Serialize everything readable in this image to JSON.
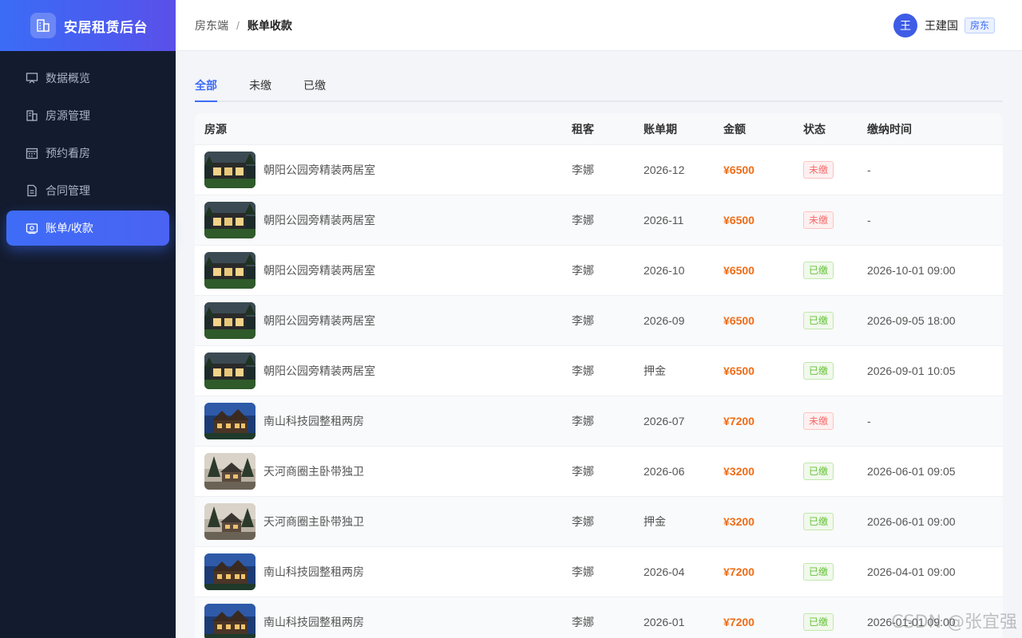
{
  "brand": {
    "title": "安居租赁后台",
    "icon": "building-icon"
  },
  "sidebar": {
    "items": [
      {
        "label": "数据概览",
        "icon": "dashboard-icon",
        "active": false
      },
      {
        "label": "房源管理",
        "icon": "building-icon",
        "active": false
      },
      {
        "label": "预约看房",
        "icon": "calendar-icon",
        "active": false
      },
      {
        "label": "合同管理",
        "icon": "document-icon",
        "active": false
      },
      {
        "label": "账单/收款",
        "icon": "bill-icon",
        "active": true
      }
    ]
  },
  "header": {
    "breadcrumb": [
      "房东端",
      "账单收款"
    ],
    "separator": "/",
    "user": {
      "avatar_text": "王",
      "name": "王建国",
      "role": "房东"
    }
  },
  "tabs": [
    {
      "label": "全部",
      "active": true
    },
    {
      "label": "未缴",
      "active": false
    },
    {
      "label": "已缴",
      "active": false
    }
  ],
  "table": {
    "columns": [
      "房源",
      "租客",
      "账单期",
      "金额",
      "状态",
      "缴纳时间"
    ],
    "rows": [
      {
        "house": "朝阳公园旁精装两居室",
        "tenant": "李娜",
        "period": "2026-12",
        "amount": "¥6500",
        "status": "未缴",
        "paid_time": "-"
      },
      {
        "house": "朝阳公园旁精装两居室",
        "tenant": "李娜",
        "period": "2026-11",
        "amount": "¥6500",
        "status": "未缴",
        "paid_time": "-"
      },
      {
        "house": "朝阳公园旁精装两居室",
        "tenant": "李娜",
        "period": "2026-10",
        "amount": "¥6500",
        "status": "已缴",
        "paid_time": "2026-10-01 09:00"
      },
      {
        "house": "朝阳公园旁精装两居室",
        "tenant": "李娜",
        "period": "2026-09",
        "amount": "¥6500",
        "status": "已缴",
        "paid_time": "2026-09-05 18:00"
      },
      {
        "house": "朝阳公园旁精装两居室",
        "tenant": "李娜",
        "period": "押金",
        "amount": "¥6500",
        "status": "已缴",
        "paid_time": "2026-09-01 10:05"
      },
      {
        "house": "南山科技园整租两房",
        "tenant": "李娜",
        "period": "2026-07",
        "amount": "¥7200",
        "status": "未缴",
        "paid_time": "-"
      },
      {
        "house": "天河商圈主卧带独卫",
        "tenant": "李娜",
        "period": "2026-06",
        "amount": "¥3200",
        "status": "已缴",
        "paid_time": "2026-06-01 09:05"
      },
      {
        "house": "天河商圈主卧带独卫",
        "tenant": "李娜",
        "period": "押金",
        "amount": "¥3200",
        "status": "已缴",
        "paid_time": "2026-06-01 09:00"
      },
      {
        "house": "南山科技园整租两房",
        "tenant": "李娜",
        "period": "2026-04",
        "amount": "¥7200",
        "status": "已缴",
        "paid_time": "2026-04-01 09:00"
      },
      {
        "house": "南山科技园整租两房",
        "tenant": "李娜",
        "period": "2026-01",
        "amount": "¥7200",
        "status": "已缴",
        "paid_time": "2026-01-01 09:00"
      }
    ]
  },
  "watermark": "CSDN @张宜强",
  "colors": {
    "accent": "#3e6cf7",
    "sidebar_bg": "#131b2e",
    "amount": "#ef6c16",
    "unpaid": "#f56c6c",
    "paid": "#67c23a"
  }
}
